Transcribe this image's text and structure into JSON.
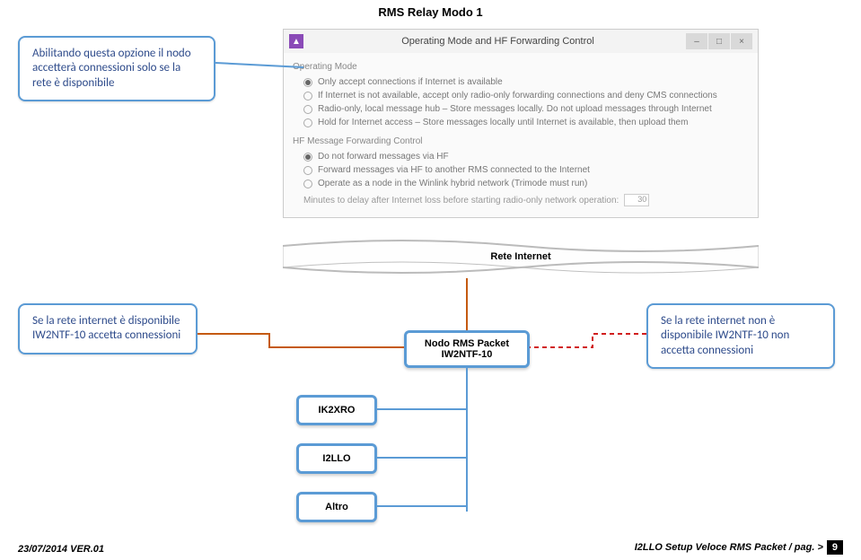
{
  "title": "RMS Relay Modo 1",
  "callouts": {
    "top_left": "Abilitando questa opzione il nodo accetterà connessioni solo se la rete è disponibile",
    "mid_left": "Se la rete internet è disponibile IW2NTF-10 accetta connessioni",
    "mid_right": "Se la rete internet non è disponibile IW2NTF-10 non accetta connessioni"
  },
  "window": {
    "title": "Operating Mode and HF Forwarding Control",
    "icon_text": "▲",
    "buttons": {
      "min": "–",
      "max": "□",
      "close": "×"
    },
    "section1_label": "Operating Mode",
    "operating_modes": [
      "Only accept connections if Internet is available",
      "If Internet is not available, accept only radio-only forwarding connections and deny CMS connections",
      "Radio-only, local message hub – Store messages locally.  Do not upload messages through Internet",
      "Hold for Internet access – Store messages locally until Internet is available, then upload them"
    ],
    "section2_label": "HF Message Forwarding Control",
    "hf_modes": [
      "Do not forward messages via HF",
      "Forward messages via HF to another RMS connected to the Internet",
      "Operate as a node in the Winlink hybrid network  (Trimode must run)"
    ],
    "delay_label": "Minutes to delay after Internet loss before starting radio-only network operation:",
    "delay_value": "30"
  },
  "internet_label": "Rete Internet",
  "node": {
    "line1": "Nodo RMS Packet",
    "line2": "IW2NTF-10"
  },
  "clients": [
    "IK2XRO",
    "I2LLO",
    "Altro"
  ],
  "footer": {
    "left": "23/07/2014 VER.01",
    "right_text": "I2LLO Setup Veloce RMS Packet  / pag. >",
    "page": "9"
  }
}
